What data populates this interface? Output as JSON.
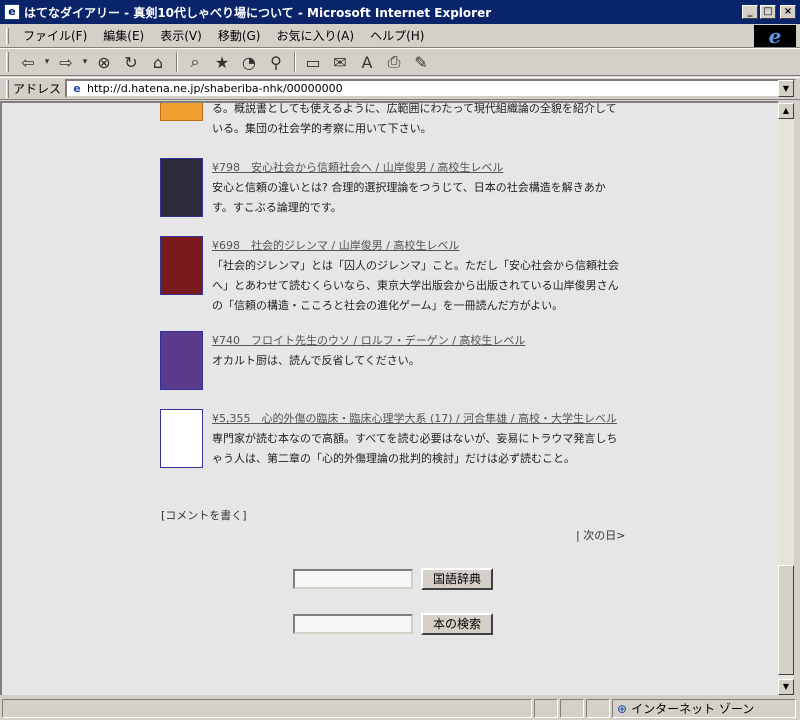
{
  "window": {
    "title": "はてなダイアリー - 真剣10代しゃべり場について - Microsoft Internet Explorer",
    "app_icon": "ie-page-icon"
  },
  "menu": [
    "ファイル(F)",
    "編集(E)",
    "表示(V)",
    "移動(G)",
    "お気に入り(A)",
    "ヘルプ(H)"
  ],
  "toolbar": [
    "back-icon",
    "forward-icon",
    "stop-icon",
    "refresh-icon",
    "home-icon",
    "search-icon",
    "favorites-icon",
    "history-icon",
    "channels-icon",
    "fullscreen-icon",
    "mail-icon",
    "font-icon",
    "print-icon",
    "edit-icon"
  ],
  "address": {
    "label": "アドレス",
    "url": "http://d.hatena.ne.jp/shaberiba-nhk/00000000"
  },
  "entries": [
    {
      "title": "",
      "desc": "る。概説書としても使えるように、広範囲にわたって現代組織論の全貌を紹介している。集団の社会学的考察に用いて下さい。",
      "cover_color": "#f0a030"
    },
    {
      "title": "¥798　安心社会から信頼社会へ / 山岸俊男 / 高校生レベル",
      "desc": "安心と信頼の違いとは? 合理的選択理論をつうじて、日本の社会構造を解きあかす。すこぶる論理的です。",
      "cover_color": "#2a2a3a"
    },
    {
      "title": "¥698　社会的ジレンマ / 山岸俊男 / 高校生レベル",
      "desc": "「社会的ジレンマ」とは「囚人のジレンマ」こと。ただし「安心社会から信頼社会へ」とあわせて読むくらいなら、東京大学出版会から出版されている山岸俊男さんの「信頼の構造・こころと社会の進化ゲーム」を一冊読んだ方がよい。",
      "cover_color": "#7a1a1a"
    },
    {
      "title": "¥740　フロイト先生のウソ / ロルフ・デーゲン / 高校生レベル",
      "desc": "オカルト厨は、読んで反省してください。",
      "cover_color": "#5a3a8a"
    },
    {
      "title": "¥5,355　心的外傷の臨床・臨床心理学大系 (17) / 河合隼雄 / 高校・大学生レベル",
      "desc": "専門家が読む本なので高額。すべてを読む必要はないが、妄易にトラウマ発言しちゃう人は、第二章の「心的外傷理論の批判的検討」だけは必ず読むこと。",
      "cover_color": "#ffffff"
    }
  ],
  "links": {
    "comment": "[コメントを書く]",
    "next_day": "| 次の日>"
  },
  "forms": {
    "dict_button": "国語辞典",
    "book_button": "本の検索"
  },
  "status": {
    "zone": "インターネット ゾーン"
  }
}
